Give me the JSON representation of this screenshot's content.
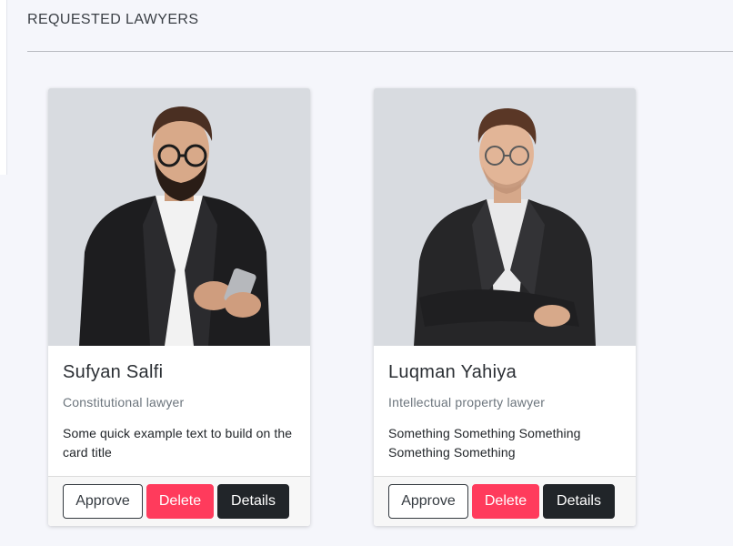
{
  "page": {
    "title": "REQUESTED LAWYERS"
  },
  "colors": {
    "background": "#f5f6fb",
    "photo_background": "#d8dbe0",
    "delete": "#ff3b5c",
    "details": "#212529"
  },
  "lawyers": [
    {
      "name": "Sufyan Salfi",
      "specialty": "Constitutional lawyer",
      "description": "Some quick example text to build on the card title",
      "photo_icon": "lawyer-photo-holding-phone"
    },
    {
      "name": "Luqman Yahiya",
      "specialty": "Intellectual property lawyer",
      "description": "Something Something Something Something Something",
      "photo_icon": "lawyer-photo-arms-crossed"
    }
  ],
  "actions": {
    "approve": "Approve",
    "delete": "Delete",
    "details": "Details"
  }
}
